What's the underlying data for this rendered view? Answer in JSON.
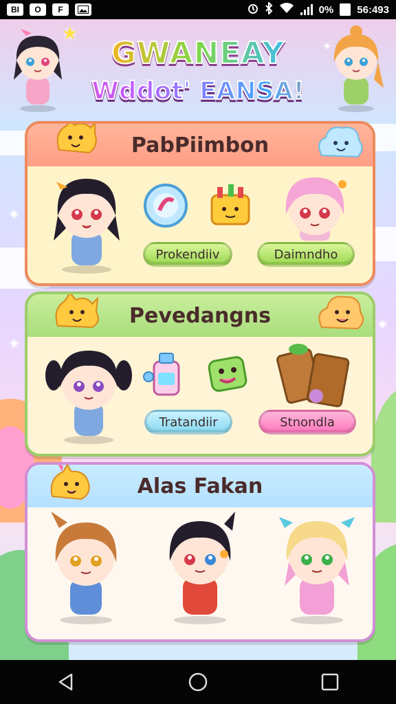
{
  "status_bar": {
    "left_items": [
      "BI",
      "O",
      "F",
      "image-icon"
    ],
    "right_text": "0%",
    "time": "56:493"
  },
  "header": {
    "title_line1": "GWANEAY",
    "title_line2": "Wddot' EANSA!"
  },
  "panels": [
    {
      "title": "PabPiimbon",
      "buttons": [
        "Prokendiiv",
        "Daimndho"
      ],
      "button_colors": [
        "#9ad84f",
        "#9ad84f"
      ]
    },
    {
      "title": "Pevedangns",
      "buttons": [
        "Tratandiir",
        "Stnondla"
      ],
      "button_colors": [
        "#88d9ef",
        "#ff78bd"
      ]
    },
    {
      "title": "Alas Fakan",
      "buttons": []
    }
  ],
  "colors": {
    "panel1_border": "#ee8a5c",
    "panel2_border": "#9ccd6a",
    "panel3_border": "#d18fd6"
  },
  "nav": {
    "back_icon": "back-icon",
    "home_icon": "home-icon",
    "recents_icon": "recents-icon"
  }
}
